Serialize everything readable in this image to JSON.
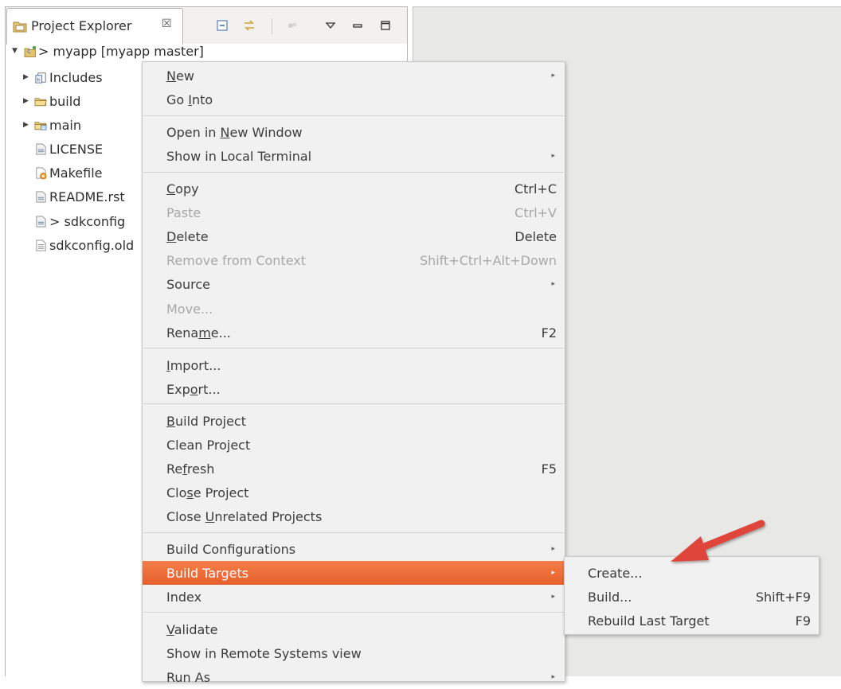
{
  "explorer": {
    "tab_title": "Project Explorer",
    "tab_close": "☒",
    "toolbar_icons": [
      "collapse-all-icon",
      "link-editor-icon",
      "filters-icon",
      "view-menu-icon",
      "minimize-icon",
      "maximize-icon"
    ],
    "tree": [
      {
        "label": "> myapp [myapp master]",
        "icon": "project-icon",
        "arrow": "▼"
      },
      {
        "label": "Includes",
        "icon": "includes-icon",
        "arrow": "▶"
      },
      {
        "label": "build",
        "icon": "folder-icon",
        "arrow": "▶"
      },
      {
        "label": "main",
        "icon": "source-folder-icon",
        "arrow": "▶"
      },
      {
        "label": "LICENSE",
        "icon": "file-icon"
      },
      {
        "label": "Makefile",
        "icon": "makefile-icon"
      },
      {
        "label": "README.rst",
        "icon": "file-icon"
      },
      {
        "label": "> sdkconfig",
        "icon": "file-icon"
      },
      {
        "label": "sdkconfig.old",
        "icon": "text-file-icon"
      }
    ]
  },
  "context_menu": {
    "items": [
      {
        "label": "New",
        "mnemonic": "N",
        "submenu": true
      },
      {
        "label": "Go Into",
        "mnemonic": "I"
      },
      {
        "label": "Open in New Window",
        "mnemonic": "N"
      },
      {
        "label": "Show in Local Terminal",
        "submenu": true
      },
      {
        "label": "Copy",
        "mnemonic": "C",
        "shortcut": "Ctrl+C"
      },
      {
        "label": "Paste",
        "shortcut": "Ctrl+V",
        "disabled": true
      },
      {
        "label": "Delete",
        "mnemonic": "D",
        "shortcut": "Delete"
      },
      {
        "label": "Remove from Context",
        "shortcut": "Shift+Ctrl+Alt+Down",
        "disabled": true
      },
      {
        "label": "Source",
        "submenu": true
      },
      {
        "label": "Move...",
        "disabled": true
      },
      {
        "label": "Rename...",
        "mnemonic": "m",
        "shortcut": "F2"
      },
      {
        "label": "Import...",
        "mnemonic": "I"
      },
      {
        "label": "Export...",
        "mnemonic": "o"
      },
      {
        "label": "Build Project",
        "mnemonic": "B"
      },
      {
        "label": "Clean Project"
      },
      {
        "label": "Refresh",
        "mnemonic": "f",
        "shortcut": "F5"
      },
      {
        "label": "Close Project",
        "mnemonic": "s"
      },
      {
        "label": "Close Unrelated Projects",
        "mnemonic": "U"
      },
      {
        "label": "Build Configurations",
        "submenu": true
      },
      {
        "label": "Build Targets",
        "submenu": true,
        "selected": true
      },
      {
        "label": "Index",
        "submenu": true
      },
      {
        "label": "Validate",
        "mnemonic": "V"
      },
      {
        "label": "Show in Remote Systems view"
      },
      {
        "label": "Run As",
        "submenu": true
      }
    ]
  },
  "submenu": {
    "items": [
      {
        "label": "Create..."
      },
      {
        "label": "Build...",
        "shortcut": "Shift+F9"
      },
      {
        "label": "Rebuild Last Target",
        "shortcut": "F9"
      }
    ]
  },
  "colors": {
    "selection": "#e8642f",
    "annotation_arrow": "#e0443a",
    "menu_bg": "#f1f1f1",
    "editor_bg": "#e8e8e7"
  }
}
